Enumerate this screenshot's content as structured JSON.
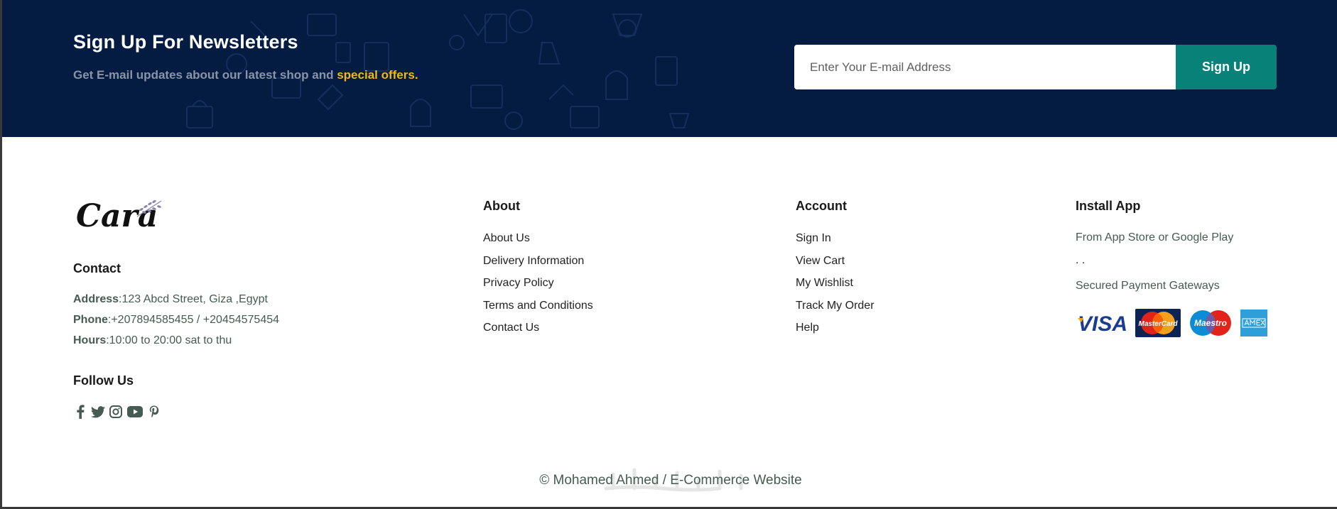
{
  "newsletter": {
    "title": "Sign Up For Newsletters",
    "subtitle_prefix": "Get E-mail updates about our latest shop and ",
    "subtitle_highlight": "special offers.",
    "input_placeholder": "Enter Your E-mail Address",
    "button_label": "Sign Up",
    "accent_color": "#f1b71c",
    "button_color": "#088178",
    "background_color": "#041c42"
  },
  "brand": {
    "logo_text": "Cara"
  },
  "contact": {
    "title": "Contact",
    "address_label": "Address",
    "address_value": ":123 Abcd Street, Giza ,Egypt",
    "phone_label": "Phone",
    "phone_value": ":+207894585455 / +20454575454",
    "hours_label": "Hours",
    "hours_value": ":10:00 to 20:00 sat to thu"
  },
  "follow": {
    "title": "Follow Us",
    "icons": [
      "facebook-icon",
      "twitter-icon",
      "instagram-icon",
      "youtube-icon",
      "pinterest-icon"
    ]
  },
  "about": {
    "title": "About",
    "links": [
      "About Us",
      "Delivery Information",
      "Privacy Policy",
      "Terms and Conditions",
      "Contact Us"
    ]
  },
  "account": {
    "title": "Account",
    "links": [
      "Sign In",
      "View Cart",
      "My Wishlist",
      "Track My Order",
      "Help"
    ]
  },
  "install_app": {
    "title": "Install App",
    "store_text": "From App Store or Google Play",
    "dots": ". .",
    "gateways_text": "Secured Payment Gateways",
    "payment_icons": [
      "visa-icon",
      "mastercard-icon",
      "maestro-icon",
      "american-express-icon"
    ]
  },
  "copyright": "© Mohamed Ahmed / E-Commerce Website"
}
